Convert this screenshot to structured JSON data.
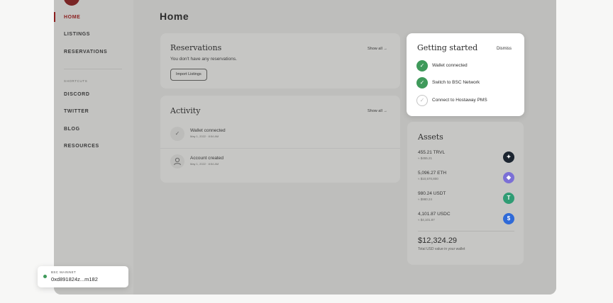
{
  "sidebar": {
    "nav": [
      {
        "label": "HOME"
      },
      {
        "label": "LISTINGS"
      },
      {
        "label": "RESERVATIONS"
      }
    ],
    "shortcuts_label": "SHORTCUTS",
    "shortcuts": [
      {
        "label": "DISCORD"
      },
      {
        "label": "TWITTER"
      },
      {
        "label": "BLOG"
      },
      {
        "label": "RESOURCES"
      }
    ]
  },
  "main": {
    "title": "Home",
    "reservations": {
      "title": "Reservations",
      "show_all": "Show all →",
      "empty_text": "You don't have any reservations.",
      "import_label": "Import Listings"
    },
    "activity": {
      "title": "Activity",
      "show_all": "Show all →",
      "items": [
        {
          "text": "Wallet connected",
          "date": "May 1, 2022 · 8:54 AM",
          "icon": "check-icon"
        },
        {
          "text": "Account created",
          "date": "May 1, 2022 · 8:54 AM",
          "icon": "user-icon"
        }
      ]
    }
  },
  "getting_started": {
    "title": "Getting started",
    "dismiss": "Dismiss",
    "items": [
      {
        "label": "Wallet connected",
        "done": true
      },
      {
        "label": "Switch to BSC Network",
        "done": true
      },
      {
        "label": "Connect to Hostaway PMS",
        "done": false
      }
    ]
  },
  "assets": {
    "title": "Assets",
    "items": [
      {
        "amount": "455.21 TRVL",
        "usd": "≈ $455.21",
        "icon": "trvl-icon",
        "color": "#1c2530"
      },
      {
        "amount": "5,096.27 ETH",
        "usd": "≈ $10,570,800",
        "icon": "eth-icon",
        "color": "#7b6fd6"
      },
      {
        "amount": "980.24 USDT",
        "usd": "≈ $980.24",
        "icon": "usdt-icon",
        "color": "#2f9c74"
      },
      {
        "amount": "4,101.87 USDC",
        "usd": "≈ $4,101.87",
        "icon": "usdc-icon",
        "color": "#2f6ad8"
      }
    ],
    "total": "$12,324.29",
    "total_label": "Total USD value in your wallet"
  },
  "network": {
    "label": "BSC MAINNET",
    "address": "0xd891824z...m182",
    "status_color": "#3f9a5b"
  }
}
